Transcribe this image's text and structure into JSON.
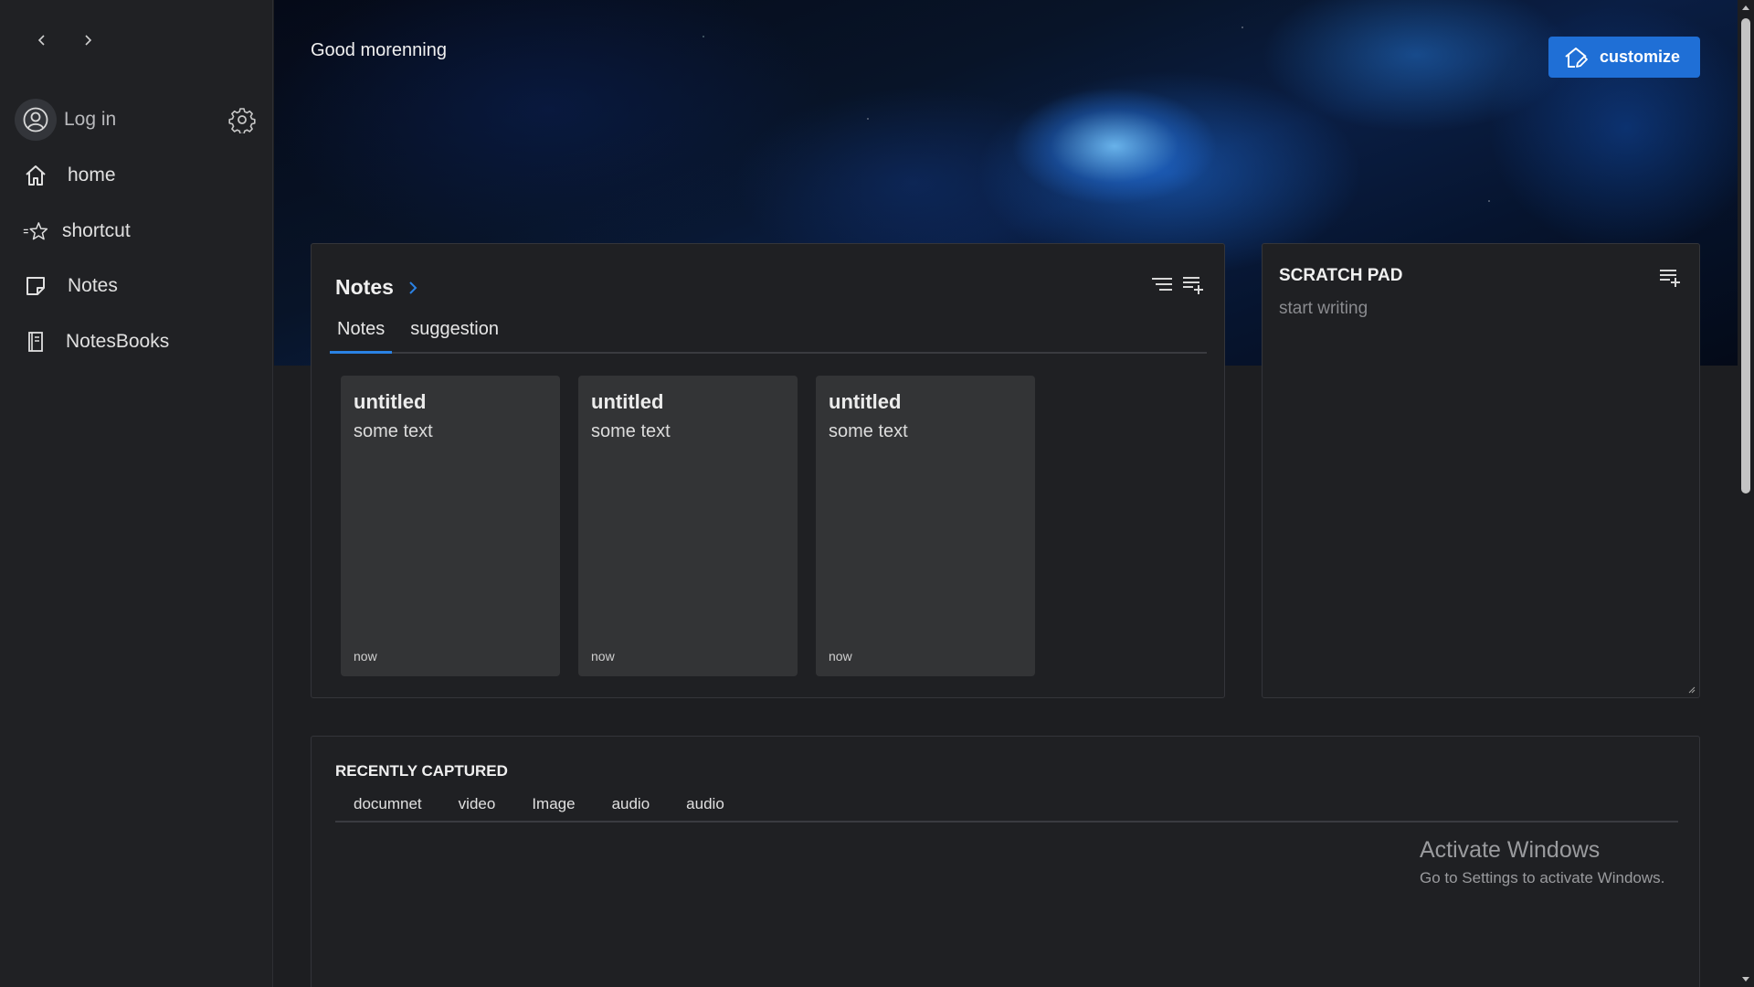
{
  "sidebar": {
    "back_icon": "chevron-left-icon",
    "forward_icon": "chevron-right-icon",
    "login_label": "Log in",
    "items": [
      {
        "label": "home",
        "icon": "home-icon"
      },
      {
        "label": "shortcut",
        "icon": "star-icon"
      },
      {
        "label": "Notes",
        "icon": "note-icon"
      },
      {
        "label": "NotesBooks",
        "icon": "notebook-icon"
      }
    ]
  },
  "hero": {
    "greeting": "Good morenning",
    "customize_label": "customize",
    "accent": "#1f6fd6"
  },
  "notes": {
    "title": "Notes",
    "tabs": [
      {
        "label": "Notes",
        "active": true
      },
      {
        "label": "suggestion",
        "active": false
      }
    ],
    "cards": [
      {
        "title": "untitled",
        "body": "some text",
        "date": "now"
      },
      {
        "title": "untitled",
        "body": "some text",
        "date": "now"
      },
      {
        "title": "untitled",
        "body": "some text",
        "date": "now"
      }
    ]
  },
  "scratch": {
    "title": "SCRATCH PAD",
    "placeholder": "start writing"
  },
  "recent": {
    "title": "RECENTLY CAPTURED",
    "tabs": [
      "documnet",
      "video",
      "Image",
      "audio",
      "audio"
    ]
  },
  "watermark": {
    "line1": "Activate Windows",
    "line2": "Go to Settings to activate Windows."
  }
}
